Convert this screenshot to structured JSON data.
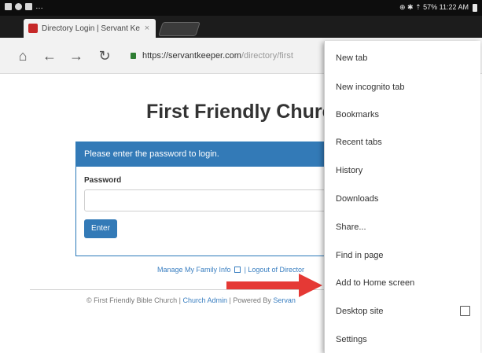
{
  "status_bar": {
    "right_text": "⊕ ✱ ⇡ 57% 11:22 AM"
  },
  "tab": {
    "title": "Directory Login | Servant Ke",
    "close_glyph": "×"
  },
  "url": {
    "secure": "https://servantkeeper.com",
    "path": "/directory/first"
  },
  "page": {
    "title": "First Friendly Churc",
    "login_header": "Please enter the password to login.",
    "password_label": "Password",
    "enter_button": "Enter",
    "manage_link": "Manage My Family Info",
    "logout_link": "| Logout of Director",
    "footer_prefix": "© First Friendly Bible Church | ",
    "footer_admin": "Church Admin",
    "footer_powered": " | Powered By ",
    "footer_brand": "Servan"
  },
  "menu": {
    "items": [
      {
        "label": "New tab"
      },
      {
        "label": "New incognito tab"
      },
      {
        "label": "Bookmarks"
      },
      {
        "label": "Recent tabs"
      },
      {
        "label": "History"
      },
      {
        "label": "Downloads"
      },
      {
        "label": "Share..."
      },
      {
        "label": "Find in page"
      },
      {
        "label": "Add to Home screen"
      },
      {
        "label": "Desktop site",
        "checkbox": false
      },
      {
        "label": "Settings"
      }
    ]
  },
  "colors": {
    "accent_blue": "#337ab7",
    "arrow_red": "#e53935",
    "favicon_red": "#c62828"
  }
}
